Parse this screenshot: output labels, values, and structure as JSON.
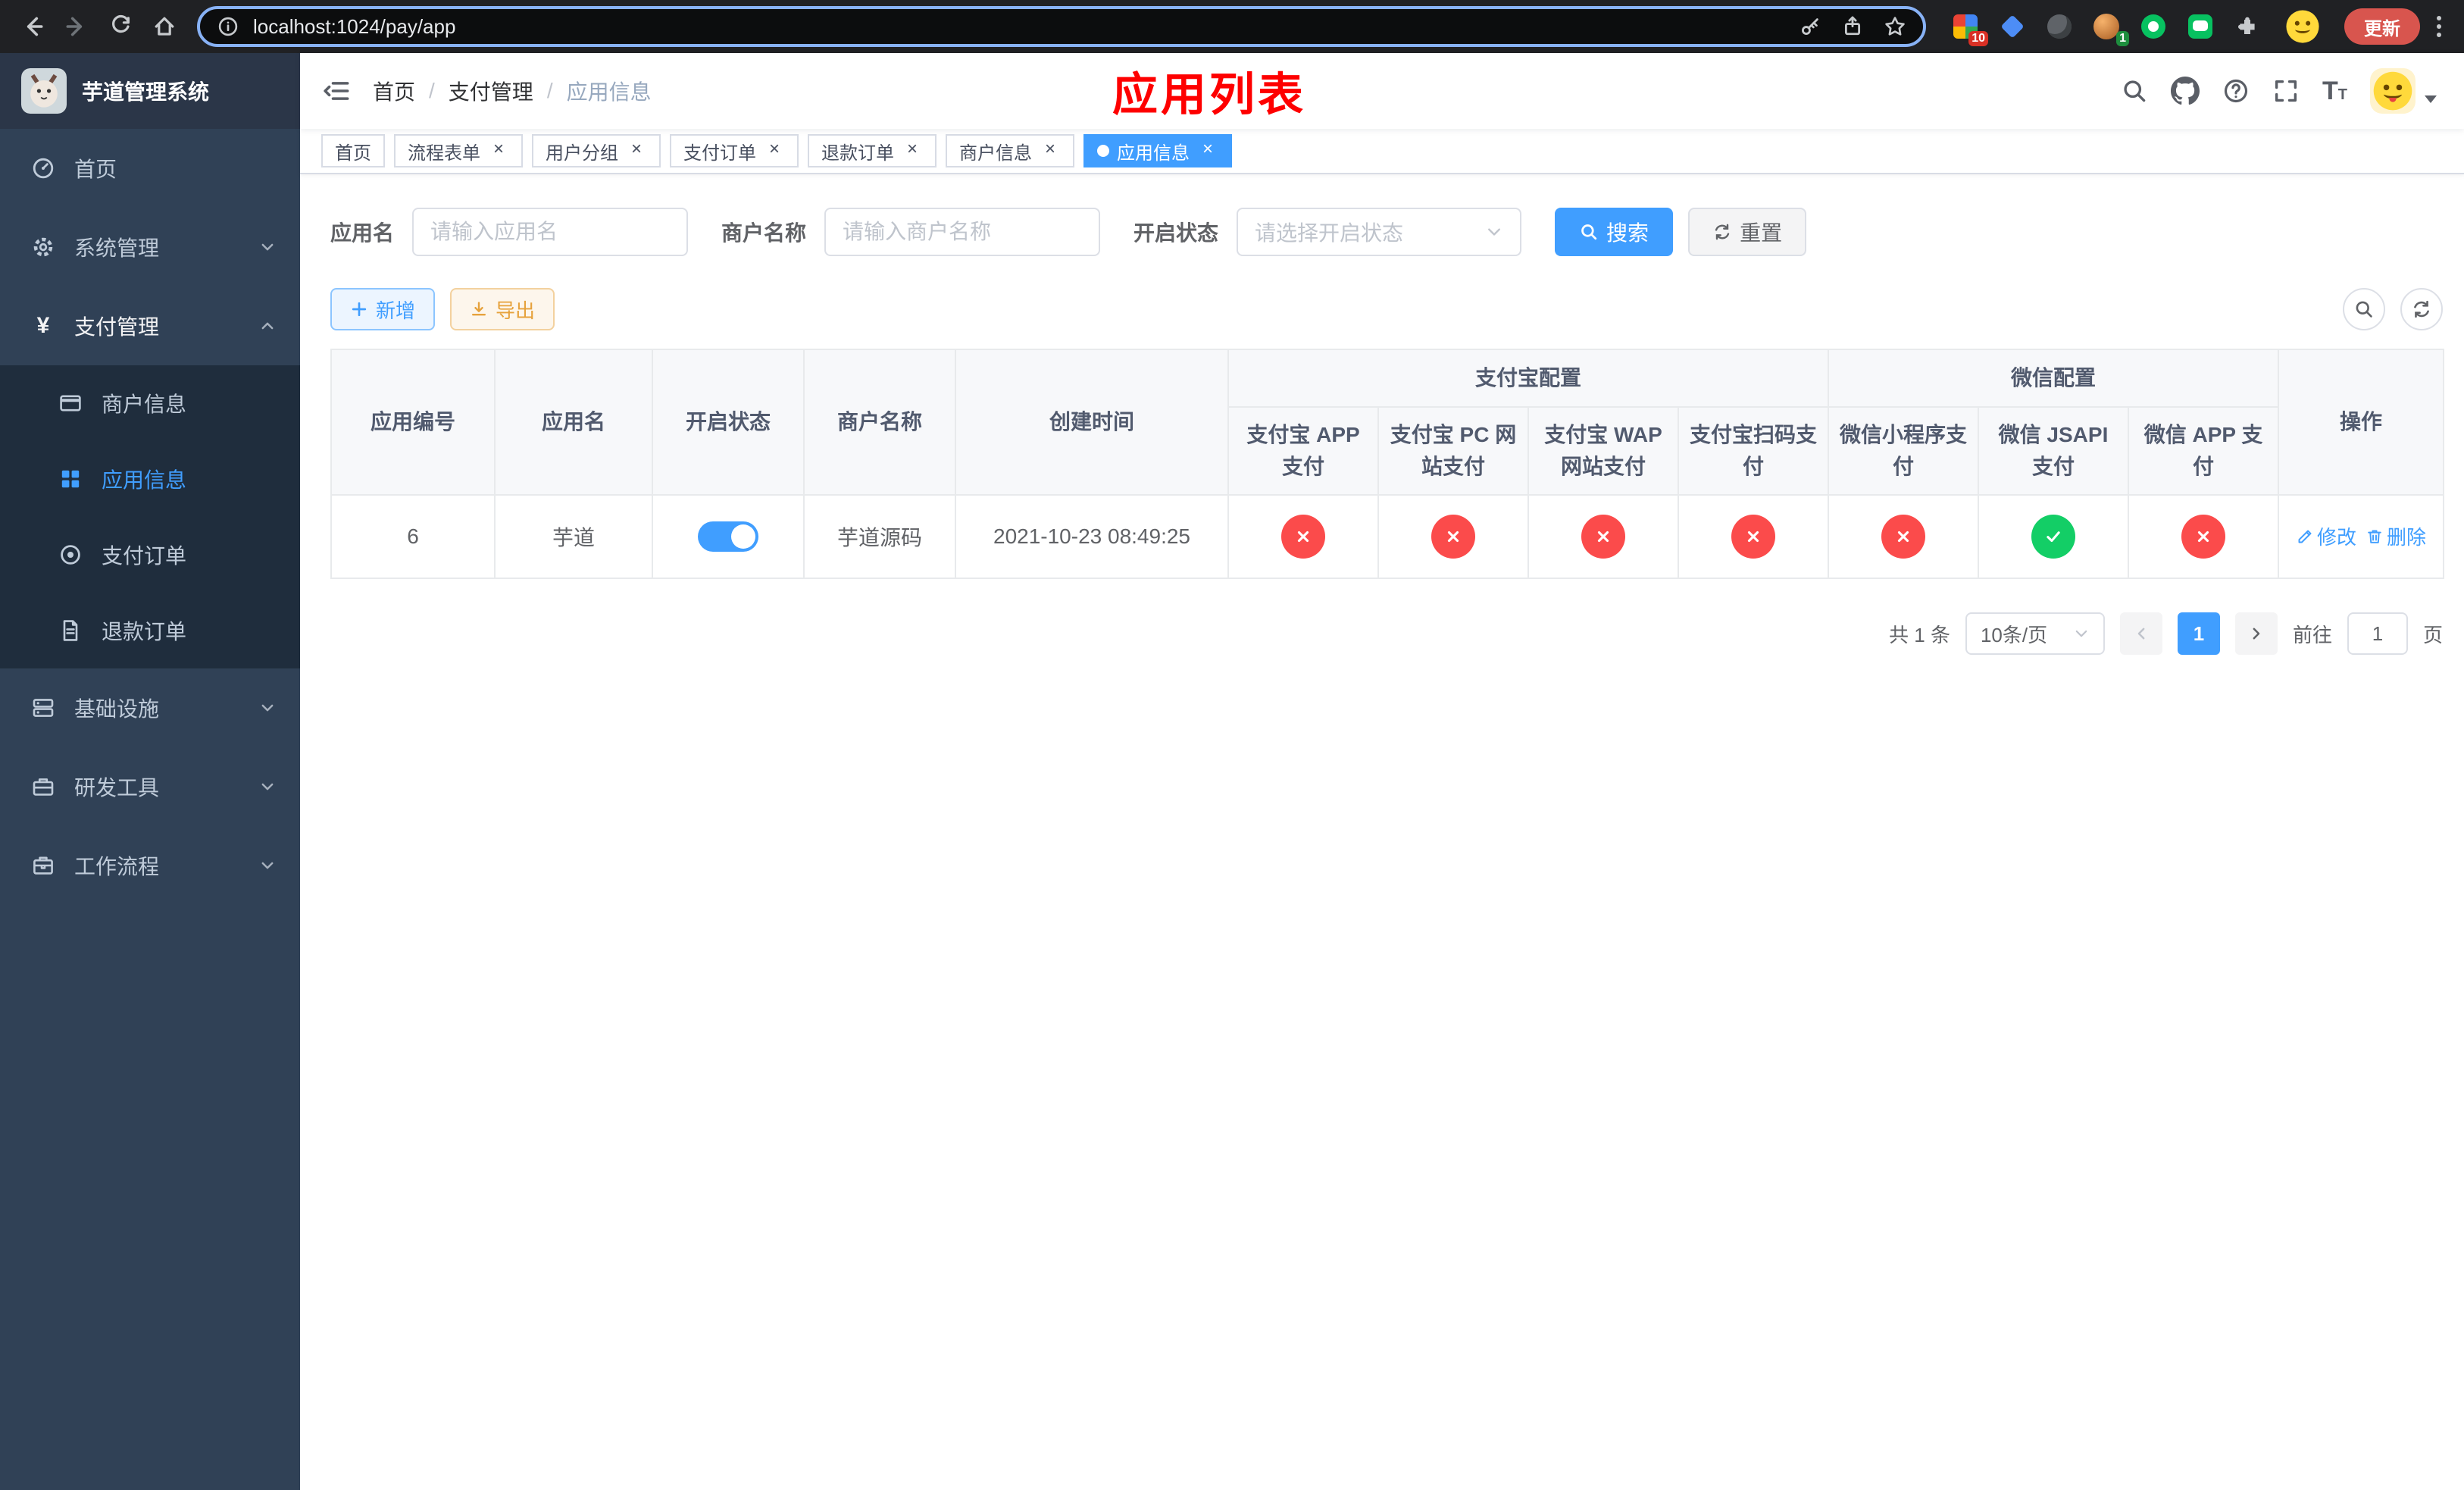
{
  "colors": {
    "accent": "#409eff",
    "success": "#13ce66",
    "danger": "#fb4b4b",
    "warning": "#e6a23c",
    "sidebar_bg": "#304156",
    "submenu_bg": "#1f2d3d",
    "overlay_title": "#fe0000"
  },
  "browser": {
    "url": "localhost:1024/pay/app",
    "update_label": "更新",
    "extension_badge_grid": "10",
    "extension_badge_avatar": "1"
  },
  "sidebar": {
    "title": "芋道管理系统",
    "items": [
      {
        "label": "首页"
      },
      {
        "label": "系统管理"
      },
      {
        "label": "支付管理",
        "children": [
          {
            "label": "商户信息"
          },
          {
            "label": "应用信息"
          },
          {
            "label": "支付订单"
          },
          {
            "label": "退款订单"
          }
        ]
      },
      {
        "label": "基础设施"
      },
      {
        "label": "研发工具"
      },
      {
        "label": "工作流程"
      }
    ]
  },
  "header": {
    "breadcrumb": [
      {
        "label": "首页"
      },
      {
        "label": "支付管理"
      },
      {
        "label": "应用信息"
      }
    ],
    "overlay_title": "应用列表"
  },
  "tabs": [
    {
      "label": "首页"
    },
    {
      "label": "流程表单"
    },
    {
      "label": "用户分组"
    },
    {
      "label": "支付订单"
    },
    {
      "label": "退款订单"
    },
    {
      "label": "商户信息"
    },
    {
      "label": "应用信息"
    }
  ],
  "filters": {
    "app_name": {
      "label": "应用名",
      "placeholder": "请输入应用名"
    },
    "merchant_name": {
      "label": "商户名称",
      "placeholder": "请输入商户名称"
    },
    "status": {
      "label": "开启状态",
      "placeholder": "请选择开启状态"
    },
    "search_label": "搜索",
    "reset_label": "重置"
  },
  "toolbar": {
    "add_label": "新增",
    "export_label": "导出"
  },
  "table": {
    "headers": {
      "app_id": "应用编号",
      "app_name": "应用名",
      "status": "开启状态",
      "merchant_name": "商户名称",
      "created_at": "创建时间",
      "alipay_group": "支付宝配置",
      "wechat_group": "微信配置",
      "alipay_app": "支付宝 APP 支付",
      "alipay_pc": "支付宝 PC 网站支付",
      "alipay_wap": "支付宝 WAP 网站支付",
      "alipay_qr": "支付宝扫码支付",
      "wechat_mini": "微信小程序支付",
      "wechat_jsapi": "微信 JSAPI 支付",
      "wechat_app": "微信 APP 支付",
      "actions": "操作"
    },
    "rows": [
      {
        "app_id": "6",
        "app_name": "芋道",
        "enabled": true,
        "merchant_name": "芋道源码",
        "created_at": "2021-10-23 08:49:25",
        "alipay_app": false,
        "alipay_pc": false,
        "alipay_wap": false,
        "alipay_qr": false,
        "wechat_mini": false,
        "wechat_jsapi": true,
        "wechat_app": false,
        "edit_label": "修改",
        "delete_label": "删除"
      }
    ]
  },
  "pagination": {
    "total_text": "共 1 条",
    "page_size_text": "10条/页",
    "current_page": "1",
    "goto_label": "前往",
    "goto_value": "1",
    "page_unit": "页"
  }
}
